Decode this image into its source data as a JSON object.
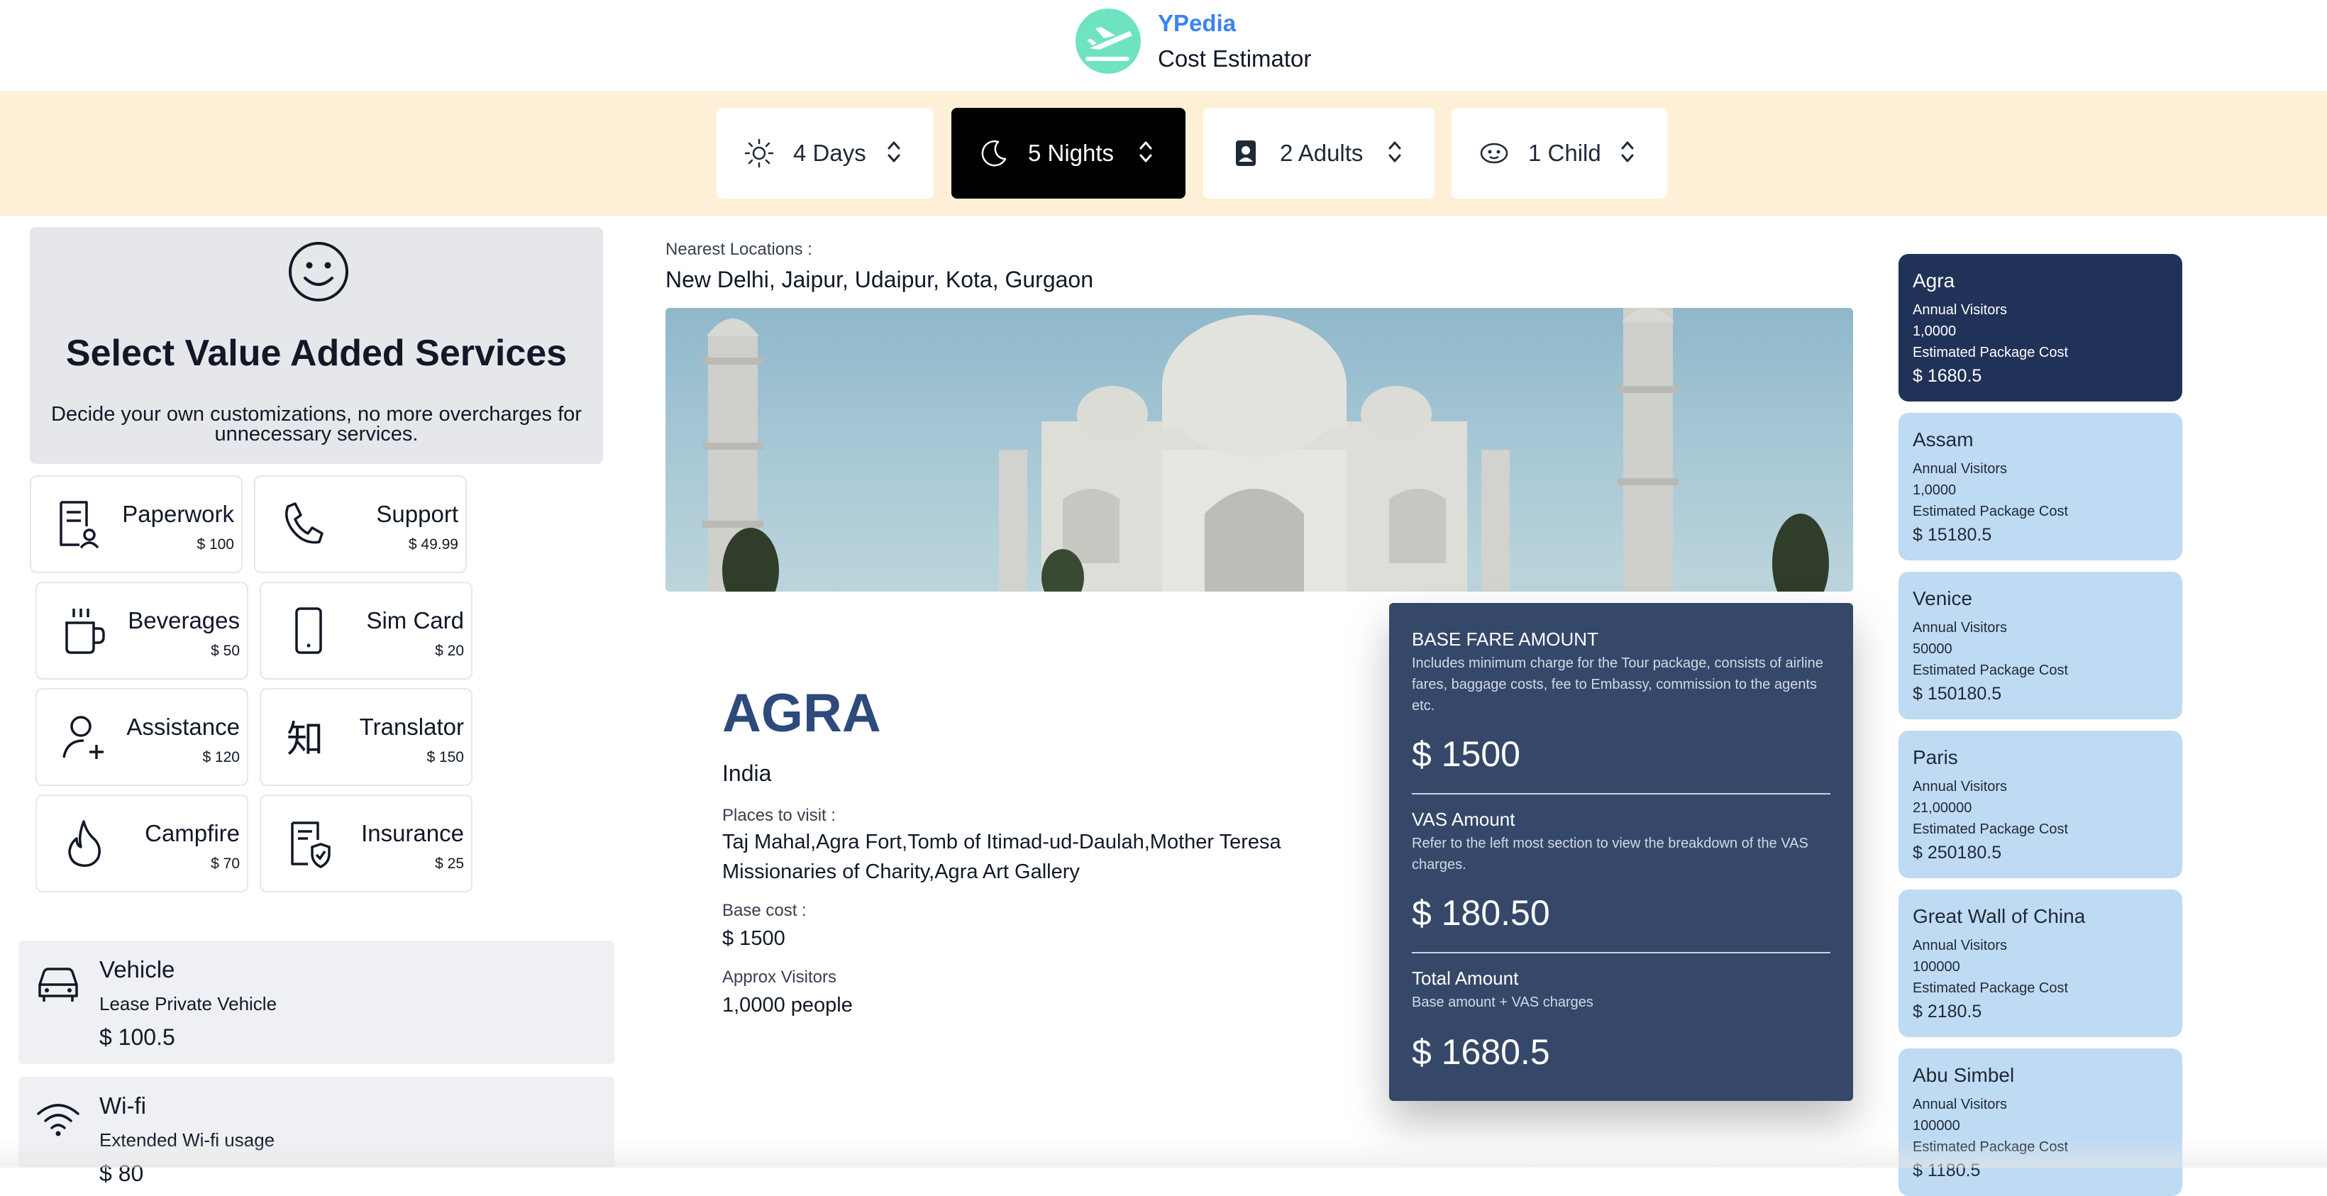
{
  "header": {
    "brand": "YPedia",
    "subtitle": "Cost Estimator"
  },
  "options": {
    "days": "4 Days",
    "nights": "5 Nights",
    "adults": "2 Adults",
    "child": "1 Child"
  },
  "vas": {
    "title": "Select Value Added Services",
    "description": "Decide your own customizations, no more overcharges for unnecessary services.",
    "services": [
      {
        "name": "Paperwork",
        "price": "$ 100",
        "icon": "paperwork-icon"
      },
      {
        "name": "Support",
        "price": "$ 49.99",
        "icon": "phone-icon"
      },
      {
        "name": "Beverages",
        "price": "$ 50",
        "icon": "mug-icon"
      },
      {
        "name": "Sim Card",
        "price": "$ 20",
        "icon": "mobile-icon"
      },
      {
        "name": "Assistance",
        "price": "$ 120",
        "icon": "user-plus-icon"
      },
      {
        "name": "Translator",
        "price": "$ 150",
        "icon": "translate-icon"
      },
      {
        "name": "Campfire",
        "price": "$ 70",
        "icon": "flame-icon"
      },
      {
        "name": "Insurance",
        "price": "$ 25",
        "icon": "shield-doc-icon"
      }
    ],
    "extras": [
      {
        "title": "Vehicle",
        "subtitle": "Lease Private Vehicle",
        "price": "$ 100.5",
        "icon": "car-icon"
      },
      {
        "title": "Wi-fi",
        "subtitle": "Extended Wi-fi usage",
        "price": "$ 80",
        "icon": "wifi-icon"
      }
    ]
  },
  "main": {
    "nearest_label": "Nearest Locations :",
    "nearest_value": "New Delhi, Jaipur, Udaipur, Kota, Gurgaon",
    "name": "AGRA",
    "country": "India",
    "places_label": "Places to visit :",
    "places_value": "Taj Mahal,Agra Fort,Tomb of Itimad-ud-Daulah,Mother Teresa Missionaries of Charity,Agra Art Gallery",
    "base_label": "Base cost :",
    "base_value": "$ 1500",
    "visitors_label": "Approx Visitors",
    "visitors_value": "1,0000 people"
  },
  "fare": {
    "base_title": "BASE FARE AMOUNT",
    "base_desc": "Includes minimum charge for the Tour package, consists of airline fares, baggage costs, fee to Embassy, commission to the agents etc.",
    "base_value": "$ 1500",
    "vas_title": "VAS Amount",
    "vas_desc": "Refer to the left most section to view the breakdown of the VAS charges.",
    "vas_value": "$ 180.50",
    "total_title": "Total Amount",
    "total_desc": "Base amount + VAS charges",
    "total_value": "$ 1680.5"
  },
  "locations": [
    {
      "name": "Agra",
      "visitors_label": "Annual Visitors",
      "visitors": "1,0000",
      "cost_label": "Estimated Package Cost",
      "cost": "$ 1680.5",
      "active": true
    },
    {
      "name": "Assam",
      "visitors_label": "Annual Visitors",
      "visitors": "1,0000",
      "cost_label": "Estimated Package Cost",
      "cost": "$ 15180.5"
    },
    {
      "name": "Venice",
      "visitors_label": "Annual Visitors",
      "visitors": "50000",
      "cost_label": "Estimated Package Cost",
      "cost": "$ 150180.5"
    },
    {
      "name": "Paris",
      "visitors_label": "Annual Visitors",
      "visitors": "21,00000",
      "cost_label": "Estimated Package Cost",
      "cost": "$ 250180.5"
    },
    {
      "name": "Great Wall of China",
      "visitors_label": "Annual Visitors",
      "visitors": "100000",
      "cost_label": "Estimated Package Cost",
      "cost": "$ 2180.5"
    },
    {
      "name": "Abu Simbel",
      "visitors_label": "Annual Visitors",
      "visitors": "100000",
      "cost_label": "Estimated Package Cost",
      "cost": "$ 1180.5"
    }
  ],
  "colors": {
    "accent": "#3b82f6",
    "options_bar": "#fdf0d6",
    "fare_panel": "#354869",
    "active_location": "#213259",
    "location_card": "#bfdbf3"
  }
}
